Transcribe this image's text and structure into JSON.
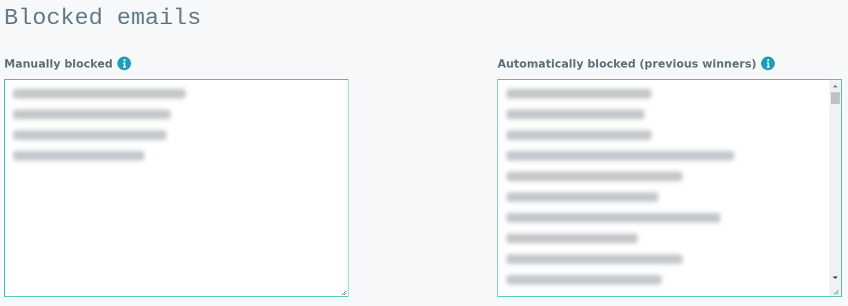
{
  "title": "Blocked emails",
  "manual": {
    "label": "Manually blocked",
    "lines": [
      {
        "kind": "redacted"
      },
      {
        "kind": "redacted"
      },
      {
        "kind": "redacted"
      },
      {
        "kind": "redacted"
      }
    ]
  },
  "automatic": {
    "label": "Automatically blocked (previous winners)",
    "lines": [
      {
        "kind": "redacted"
      },
      {
        "kind": "redacted"
      },
      {
        "kind": "redacted"
      },
      {
        "kind": "redacted"
      },
      {
        "kind": "redacted"
      },
      {
        "kind": "redacted"
      },
      {
        "kind": "redacted"
      },
      {
        "kind": "redacted"
      },
      {
        "kind": "redacted"
      },
      {
        "kind": "redacted"
      }
    ]
  }
}
